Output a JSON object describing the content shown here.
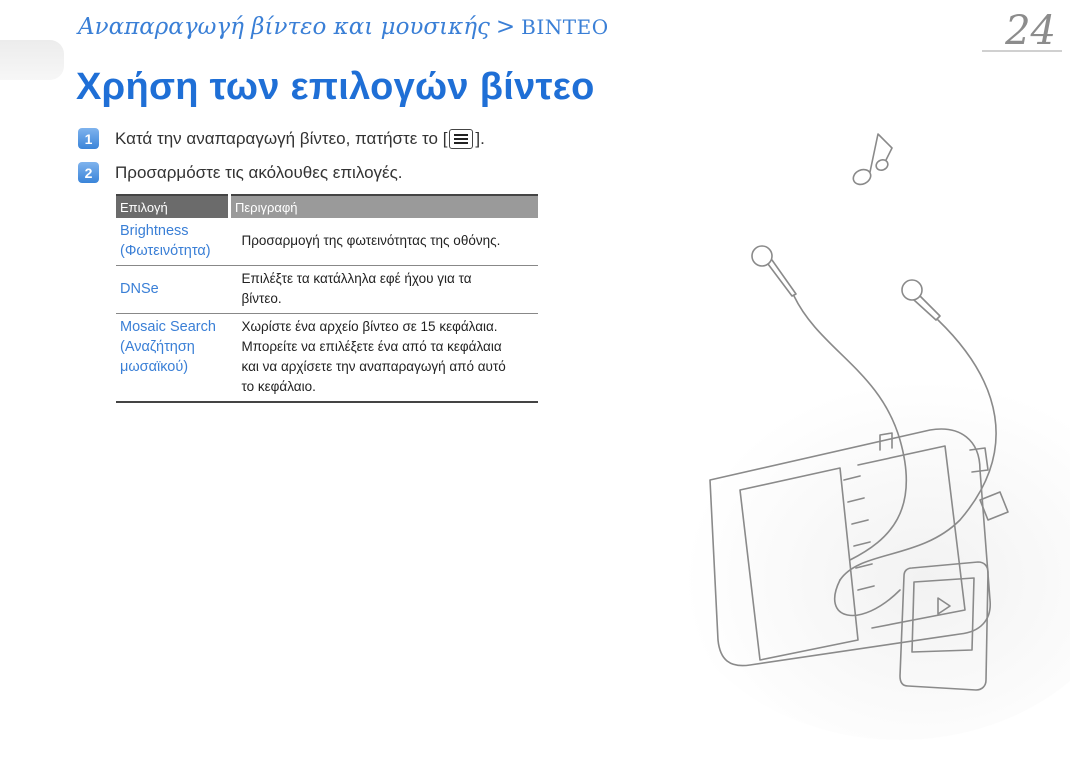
{
  "header": {
    "breadcrumb_parent": "Αναπαραγωγή βίντεο και μουσικής",
    "breadcrumb_separator": ">",
    "breadcrumb_section": "BINTEO",
    "page_number": "24"
  },
  "title": "Χρήση των επιλογών βίντεο",
  "steps": [
    {
      "num": "1",
      "text_before": "Κατά την αναπαραγωγή βίντεο, πατήστε το [",
      "icon": "menu-icon",
      "text_after": "]."
    },
    {
      "num": "2",
      "text": "Προσαρμόστε τις ακόλουθες επιλογές."
    }
  ],
  "table": {
    "headers": [
      "Επιλογή",
      "Περιγραφή"
    ],
    "rows": [
      {
        "option": [
          "Brightness",
          "(Φωτεινότητα)"
        ],
        "description": [
          "Προσαρμογή της φωτεινότητας της οθόνης."
        ]
      },
      {
        "option": [
          "DNSe"
        ],
        "description": [
          "Επιλέξτε τα κατάλληλα εφέ ήχου για τα",
          "βίντεο."
        ]
      },
      {
        "option": [
          "Mosaic Search",
          "(Αναζήτηση",
          "μωσαϊκού)"
        ],
        "description": [
          "Χωρίστε ένα αρχείο βίντεο σε 15 κεφάλαια.",
          "Μπορείτε να επιλέξετε ένα από τα κεφάλαια",
          "και να αρχίσετε την αναπαραγωγή από αυτό",
          "το κεφάλαιο."
        ]
      }
    ]
  },
  "colors": {
    "accent": "#1f6fd6",
    "link_blue": "#3a7fd6"
  }
}
